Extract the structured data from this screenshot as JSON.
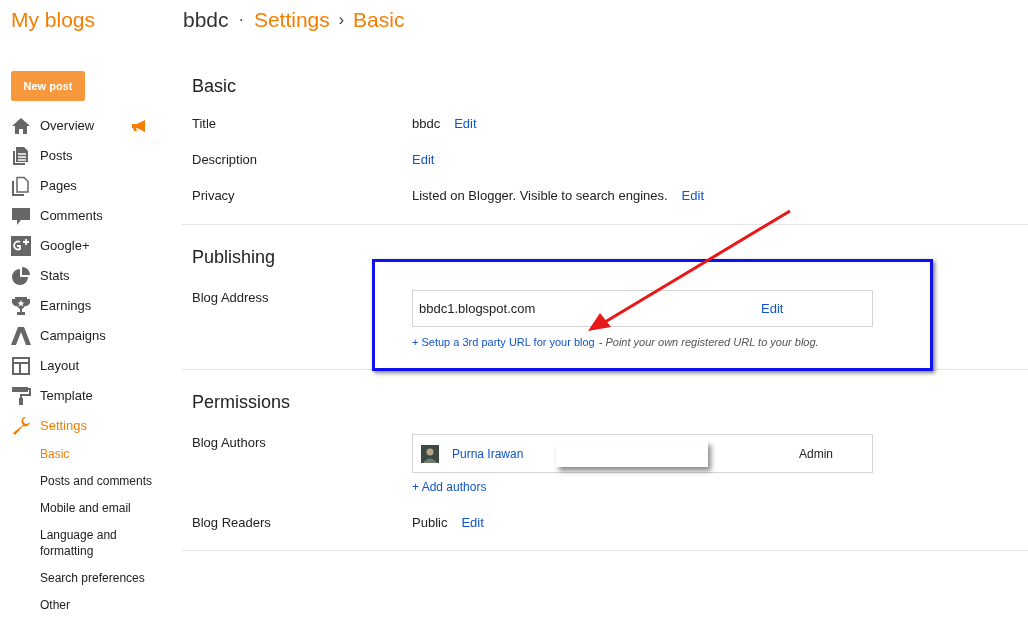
{
  "header": {
    "home": "My blogs",
    "blog": "bbdc",
    "separator_1": "·",
    "section": "Settings",
    "separator_2": "›",
    "page": "Basic"
  },
  "sidebar": {
    "new_post": "New post",
    "items": [
      {
        "label": "Overview",
        "selected": false,
        "badge": true
      },
      {
        "label": "Posts",
        "selected": false,
        "badge": false
      },
      {
        "label": "Pages",
        "selected": false,
        "badge": false
      },
      {
        "label": "Comments",
        "selected": false,
        "badge": false
      },
      {
        "label": "Google+",
        "selected": false,
        "badge": false
      },
      {
        "label": "Stats",
        "selected": false,
        "badge": false
      },
      {
        "label": "Earnings",
        "selected": false,
        "badge": false
      },
      {
        "label": "Campaigns",
        "selected": false,
        "badge": false
      },
      {
        "label": "Layout",
        "selected": false,
        "badge": false
      },
      {
        "label": "Template",
        "selected": false,
        "badge": false
      },
      {
        "label": "Settings",
        "selected": true,
        "badge": false
      }
    ],
    "subitems": [
      {
        "label": "Basic",
        "selected": true
      },
      {
        "label": "Posts and comments",
        "selected": false
      },
      {
        "label": "Mobile and email",
        "selected": false
      },
      {
        "label": "Language and formatting",
        "selected": false
      },
      {
        "label": "Search preferences",
        "selected": false
      },
      {
        "label": "Other",
        "selected": false
      }
    ]
  },
  "sections": [
    {
      "title": "Basic",
      "rows": [
        {
          "kind": "value",
          "label": "Title",
          "value": "bbdc",
          "edit": "Edit"
        },
        {
          "kind": "value",
          "label": "Description",
          "edit": "Edit"
        },
        {
          "kind": "value",
          "label": "Privacy",
          "value": "Listed on Blogger. Visible to search engines.",
          "edit": "Edit"
        }
      ]
    },
    {
      "title": "Publishing",
      "rows": [
        {
          "kind": "address",
          "label": "Blog Address",
          "address": "bbdc1.blogspot.com",
          "edit": "Edit",
          "link": "+ Setup a 3rd party URL for your blog",
          "hint": "- Point your own registered URL to your blog."
        }
      ]
    },
    {
      "title": "Permissions",
      "rows": [
        {
          "kind": "authors",
          "label": "Blog Authors",
          "author": "Purna Irawan",
          "role": "Admin",
          "link": "+ Add authors"
        },
        {
          "kind": "value",
          "label": "Blog Readers",
          "value": "Public",
          "edit": "Edit"
        }
      ]
    }
  ]
}
